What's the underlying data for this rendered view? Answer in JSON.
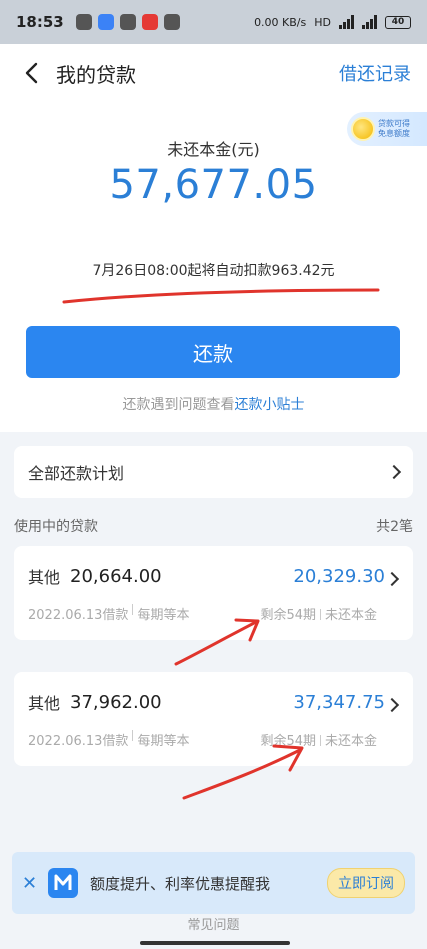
{
  "status_bar": {
    "time": "18:53",
    "network_speed": "0.00\nKB/s",
    "network_type": "HD",
    "battery": "40"
  },
  "nav": {
    "title": "我的贷款",
    "records": "借还记录"
  },
  "promo": {
    "line1": "贷款可得",
    "line2": "免息额度"
  },
  "summary": {
    "principal_label": "未还本金(元)",
    "principal_amount": "57,677.05",
    "auto_deduct_text": "7月26日08:00起将自动扣款963.42元",
    "repay_button": "还款",
    "tip_prefix": "还款遇到问题查看",
    "tip_link": "还款小贴士"
  },
  "plan": {
    "label": "全部还款计划"
  },
  "loans_section": {
    "title": "使用中的贷款",
    "count": "共2笔"
  },
  "loans": [
    {
      "type": "其他",
      "amount": "20,664.00",
      "date_text": "2022.06.13借款",
      "method": "每期等本",
      "remaining_periods": "剩余54期",
      "remaining_label": "未还本金",
      "remaining_amount": "20,329.30"
    },
    {
      "type": "其他",
      "amount": "37,962.00",
      "date_text": "2022.06.13借款",
      "method": "每期等本",
      "remaining_periods": "剩余54期",
      "remaining_label": "未还本金",
      "remaining_amount": "37,347.75"
    }
  ],
  "subscribe": {
    "message": "额度提升、利率优惠提醒我",
    "button": "立即订阅"
  },
  "footer": {
    "faq": "常见问题"
  },
  "colors": {
    "accent": "#2b7fd6",
    "button": "#2b86f0",
    "annotation_red": "#e0342c"
  }
}
